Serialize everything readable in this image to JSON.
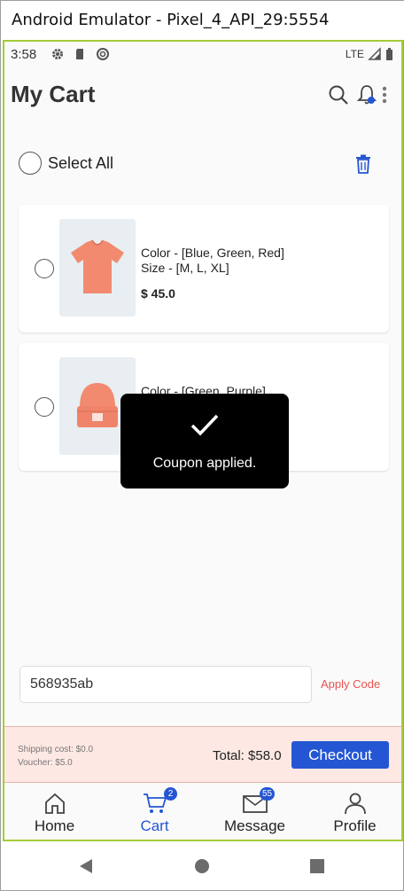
{
  "window": {
    "title": "Android Emulator - Pixel_4_API_29:5554"
  },
  "status_bar": {
    "time": "3:58",
    "network": "LTE"
  },
  "app_bar": {
    "title": "My Cart"
  },
  "select_all": {
    "label": "Select All"
  },
  "cart_items": [
    {
      "color_line": "Color - [Blue, Green, Red]",
      "size_line": "Size - [M, L, XL]",
      "price": "$ 45.0",
      "image": "tshirt-icon"
    },
    {
      "color_line": "Color - [Green, Purple]",
      "size_line": "",
      "price": "",
      "image": "beanie-icon"
    }
  ],
  "toast": {
    "message": "Coupon applied.",
    "icon": "check-icon"
  },
  "coupon": {
    "value": "568935ab",
    "apply_label": "Apply Code"
  },
  "summary": {
    "shipping": "Shipping cost: $0.0",
    "voucher": "Voucher: $5.0",
    "total": "Total: $58.0",
    "checkout_label": "Checkout"
  },
  "bottom_nav": [
    {
      "label": "Home",
      "icon": "home-icon",
      "active": false
    },
    {
      "label": "Cart",
      "icon": "cart-icon",
      "active": true,
      "badge": "2"
    },
    {
      "label": "Message",
      "icon": "mail-icon",
      "active": false,
      "badge": "55"
    },
    {
      "label": "Profile",
      "icon": "person-icon",
      "active": false
    }
  ],
  "colors": {
    "accent": "#2456d4",
    "apply": "#e5554f",
    "summary_bg": "#fde8e4",
    "product": "#f28a70"
  }
}
